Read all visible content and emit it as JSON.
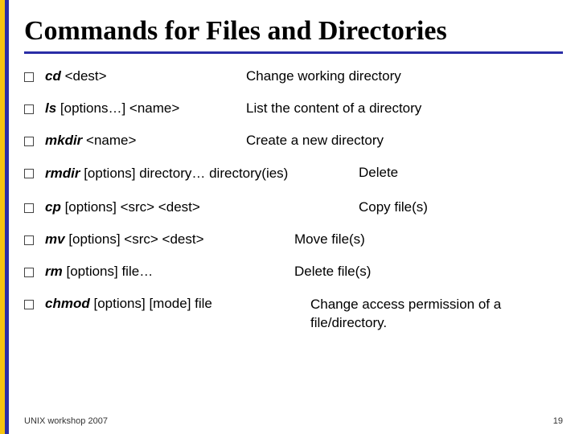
{
  "title": "Commands for Files and Directories",
  "items": [
    {
      "cmd": "cd",
      "args": "<dest>",
      "desc": "Change working directory"
    },
    {
      "cmd": "ls",
      "args": "[options…] <name>",
      "desc": "List the content of a directory"
    },
    {
      "cmd": "mkdir",
      "args": "<name>",
      "desc": "Create a new directory"
    },
    {
      "cmd": "rmdir",
      "args": "[options] directory… directory(ies)",
      "desc": "Delete"
    },
    {
      "cmd": "cp",
      "args": "[options] <src> <dest>",
      "desc": "Copy file(s)"
    },
    {
      "cmd": "mv",
      "args": "[options] <src> <dest>",
      "desc": "Move file(s)"
    },
    {
      "cmd": "rm",
      "args": "[options] file…",
      "desc": "Delete file(s)"
    },
    {
      "cmd": "chmod",
      "args": "[options] [mode] file",
      "desc": "Change access permission of a file/directory."
    }
  ],
  "footer": {
    "left": "UNIX workshop 2007",
    "page": "19"
  }
}
